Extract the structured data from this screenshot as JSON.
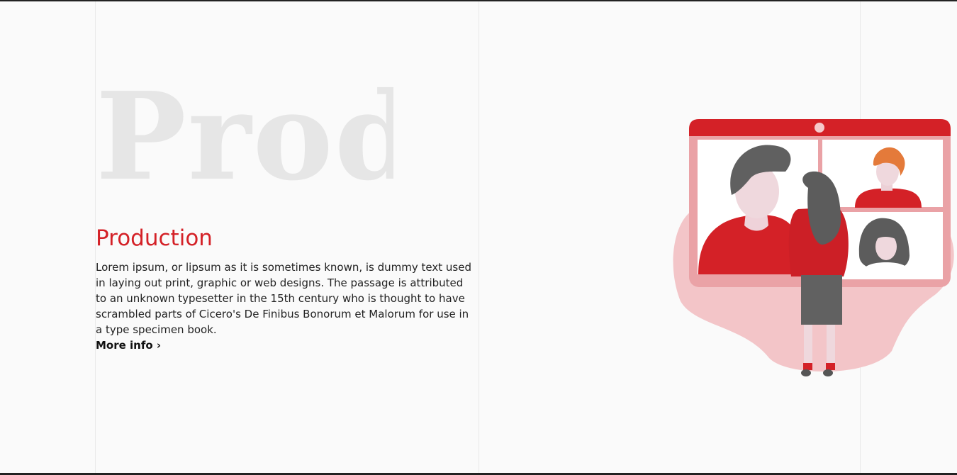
{
  "hero": {
    "background_word": "Prod",
    "title": "Production",
    "description": "Lorem ipsum, or lipsum as it is sometimes known, is dummy text used in laying out print, graphic or web designs. The passage is attributed to an unknown typesetter in the 15th century who is thought to have scrambled parts of Cicero's De Finibus Bonorum et Malorum for use in a type specimen book.",
    "link_label": "More info ›"
  },
  "colors": {
    "accent": "#d42127",
    "background": "#fafafa",
    "text": "#222222",
    "blob": "#f3c5c8"
  },
  "illustration": {
    "icon": "video-conference-illustration"
  }
}
